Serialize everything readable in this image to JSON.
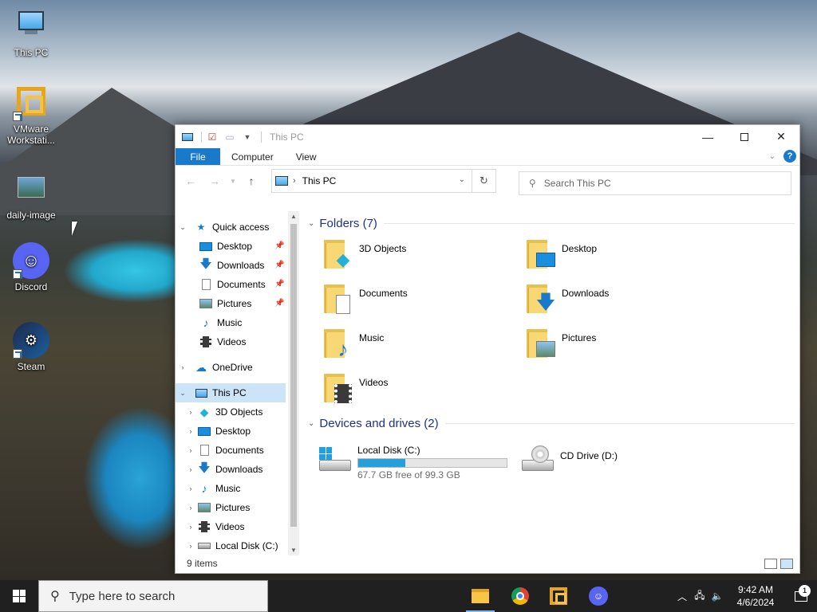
{
  "desktop": {
    "icons": [
      {
        "label": "This PC",
        "icon": "monitor-icon"
      },
      {
        "label": "VMware Workstati...",
        "icon": "vmware-icon"
      },
      {
        "label": "daily-image",
        "icon": "image-icon"
      },
      {
        "label": "Discord",
        "icon": "discord-icon"
      },
      {
        "label": "Steam",
        "icon": "steam-icon"
      }
    ]
  },
  "window": {
    "title": "This PC",
    "ribbon": {
      "file": "File",
      "computer": "Computer",
      "view": "View",
      "help": "?"
    },
    "address": {
      "crumb": "This PC"
    },
    "search": {
      "placeholder": "Search This PC"
    },
    "sidebar": {
      "quick_access": "Quick access",
      "quick_items": [
        "Desktop",
        "Downloads",
        "Documents",
        "Pictures",
        "Music",
        "Videos"
      ],
      "onedrive": "OneDrive",
      "this_pc": "This PC",
      "pc_items": [
        "3D Objects",
        "Desktop",
        "Documents",
        "Downloads",
        "Music",
        "Pictures",
        "Videos",
        "Local Disk (C:)"
      ]
    },
    "folders_header": "Folders (7)",
    "folders": [
      "3D Objects",
      "Desktop",
      "Documents",
      "Downloads",
      "Music",
      "Pictures",
      "Videos"
    ],
    "drives_header": "Devices and drives (2)",
    "drives": [
      {
        "name": "Local Disk (C:)",
        "free": "67.7 GB free of 99.3 GB",
        "used_fraction": 0.318
      },
      {
        "name": "CD Drive (D:)"
      }
    ],
    "status": "9 items"
  },
  "taskbar": {
    "search_placeholder": "Type here to search",
    "time": "9:42 AM",
    "date": "4/6/2024",
    "notification_count": "1"
  },
  "colors": {
    "accent": "#1979ca",
    "selection": "#cce4f7",
    "drive_bar": "#26a0da",
    "taskbar": "#202020"
  }
}
